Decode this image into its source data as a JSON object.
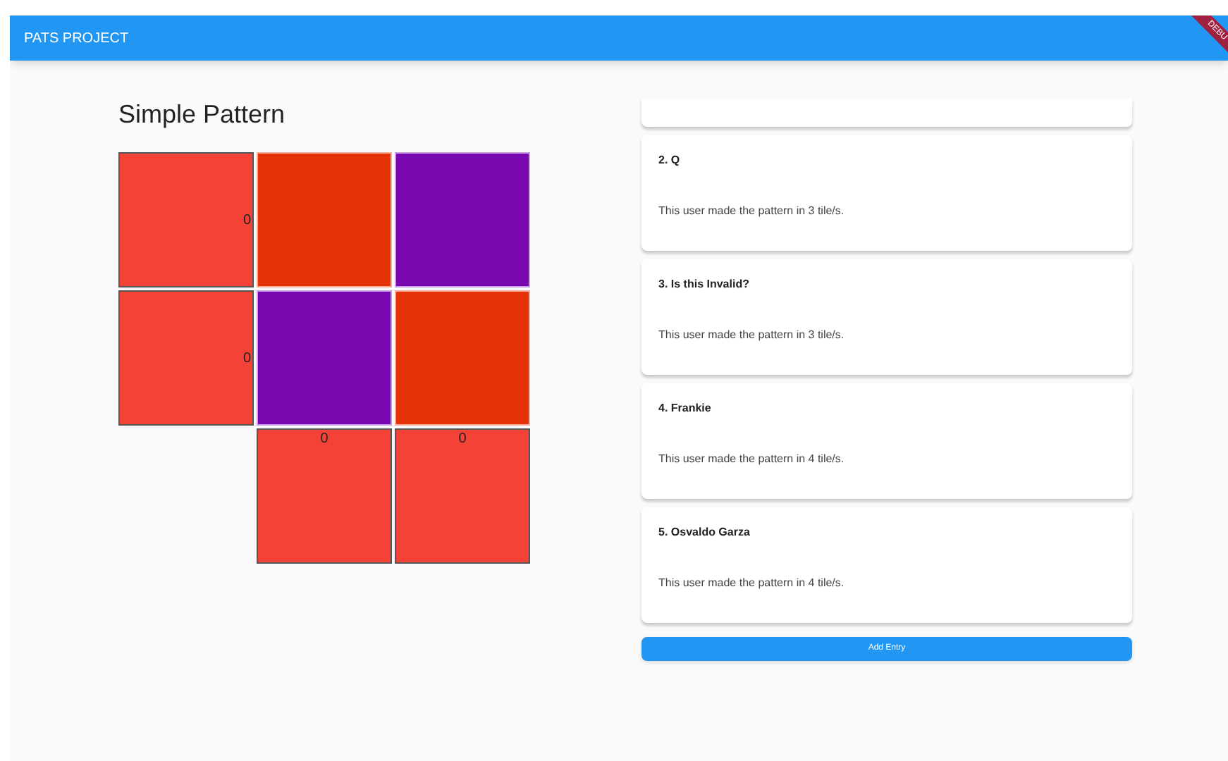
{
  "app_bar": {
    "title": "PATS PROJECT",
    "banner": "DEBU"
  },
  "pattern": {
    "title": "Simple Pattern",
    "tiles": [
      {
        "kind": "side-label",
        "color": "#f44336",
        "label": "0"
      },
      {
        "kind": "plain",
        "color": "#e53206"
      },
      {
        "kind": "plain",
        "color": "#7807b0"
      },
      {
        "kind": "side-label",
        "color": "#f44336",
        "label": "0"
      },
      {
        "kind": "plain",
        "color": "#7807b0"
      },
      {
        "kind": "plain",
        "color": "#e53206"
      },
      {
        "kind": "empty"
      },
      {
        "kind": "top-label",
        "color": "#f44336",
        "label": "0"
      },
      {
        "kind": "top-label",
        "color": "#f44336",
        "label": "0"
      }
    ]
  },
  "entries": [
    {
      "title": "2. Q",
      "text": "This user made the pattern in 3 tile/s."
    },
    {
      "title": "3. Is this Invalid?",
      "text": "This user made the pattern in 3 tile/s."
    },
    {
      "title": "4. Frankie",
      "text": "This user made the pattern in 4 tile/s."
    },
    {
      "title": "5. Osvaldo Garza",
      "text": "This user made the pattern in 4 tile/s."
    }
  ],
  "add_button": "Add Entry"
}
